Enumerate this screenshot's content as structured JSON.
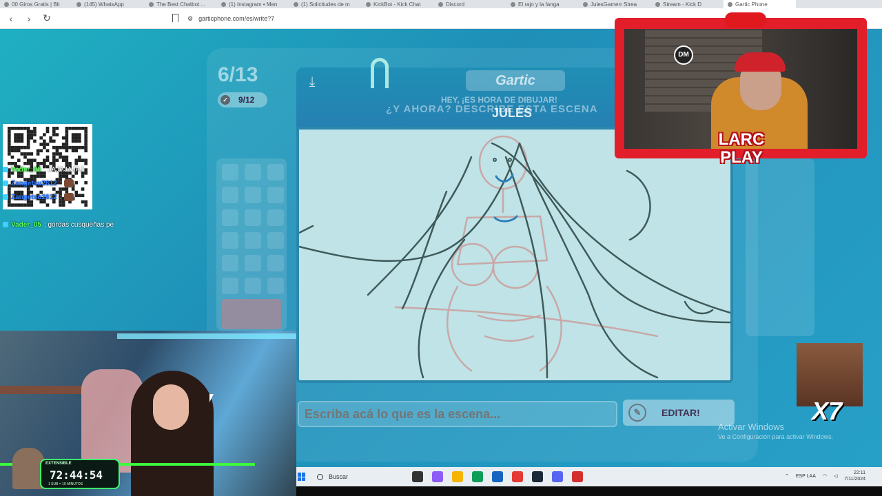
{
  "browser": {
    "tabs": [
      {
        "label": "00 Giros Gratis | Bit"
      },
      {
        "label": "(145) WhatsApp"
      },
      {
        "label": "The Best Chatbot ..."
      },
      {
        "label": "(1) Instagram • Men"
      },
      {
        "label": "(1) Solicitudes de m"
      },
      {
        "label": "KickBot - Kick Chat"
      },
      {
        "label": "Discord"
      },
      {
        "label": "El rajo y la fanga"
      },
      {
        "label": "JulesGamerr Strea"
      },
      {
        "label": "Stream - Kick D"
      },
      {
        "label": "Gartic Phone"
      }
    ],
    "url": "garticphone.com/es/write?7"
  },
  "game": {
    "round": "6/13",
    "done_count": "9/12",
    "logo": "Gartic",
    "hey_text": "HEY, ¡ES HORA DE DIBUJAR!",
    "question_text": "¿Y AHORA? DESCRIBE ESTA ESCENA",
    "author": "JULES",
    "answer_placeholder": "Escriba acá lo que es la escena...",
    "edit_label": "EDITAR!"
  },
  "windows_notice": {
    "line1": "Activar Windows",
    "line2": "Ve a Configuración para activar Windows."
  },
  "chat": {
    "messages": [
      {
        "user": "Vader_05",
        "text": ": JAJAJAJAJ"
      },
      {
        "user": "Zangetsu2612",
        "text": ":"
      },
      {
        "user": "Zangetsu2612",
        "text": ":"
      },
      {
        "user": "Vader_05",
        "text": ": gordas cusqueñas pe"
      }
    ]
  },
  "stream": {
    "timer_label": "EXTENSIBLE",
    "timer": "72:44:54",
    "timer_sub": "1 SUB = 10 MINUTOS",
    "cam_logo": "DM",
    "brand": "LARC PLAY",
    "multiplier": "X7"
  },
  "taskbar": {
    "search_label": "Buscar",
    "lang": "ESP LAA",
    "time": "22:11",
    "date": "7/11/2024"
  },
  "colors": {
    "game_bg": "#1fa2b3",
    "canvas_bg": "#bfe3e6",
    "cam_frame": "#e21e2a",
    "timer_border": "#3cff6c"
  }
}
